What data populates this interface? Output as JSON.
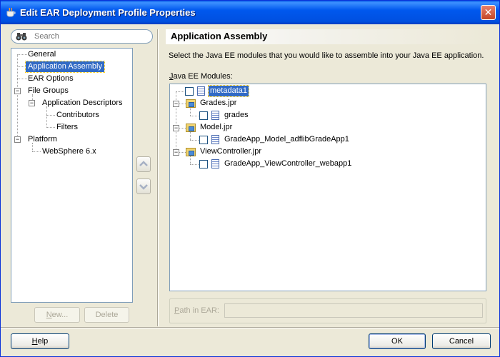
{
  "window": {
    "title": "Edit EAR Deployment Profile Properties"
  },
  "search": {
    "placeholder": "Search"
  },
  "nav": {
    "items": [
      {
        "label": "General"
      },
      {
        "label": "Application Assembly"
      },
      {
        "label": "EAR Options"
      },
      {
        "label": "File Groups"
      },
      {
        "label": "Application Descriptors"
      },
      {
        "label": "Contributors"
      },
      {
        "label": "Filters"
      },
      {
        "label": "Platform"
      },
      {
        "label": "WebSphere 6.x"
      }
    ],
    "selected": "Application Assembly"
  },
  "left_buttons": {
    "new_prefix": "N",
    "new_rest": "ew...",
    "delete_label": "Delete"
  },
  "panel": {
    "title": "Application Assembly",
    "description": "Select the Java EE modules that you would like to assemble into your Java EE application.",
    "modules_label_prefix": "J",
    "modules_label_rest": "ava EE Modules:"
  },
  "modules": [
    {
      "label": "metadata1",
      "checked": false
    },
    {
      "label": "Grades.jpr"
    },
    {
      "label": "grades",
      "checked": false
    },
    {
      "label": "Model.jpr"
    },
    {
      "label": "GradeApp_Model_adflibGradeApp1",
      "checked": false
    },
    {
      "label": "ViewController.jpr"
    },
    {
      "label": "GradeApp_ViewController_webapp1",
      "checked": false
    }
  ],
  "path_in_ear": {
    "label_prefix": "P",
    "label_rest": "ath in EAR:",
    "value": ""
  },
  "footer": {
    "help_prefix": "H",
    "help_rest": "elp",
    "ok_label": "OK",
    "cancel_label": "Cancel"
  }
}
